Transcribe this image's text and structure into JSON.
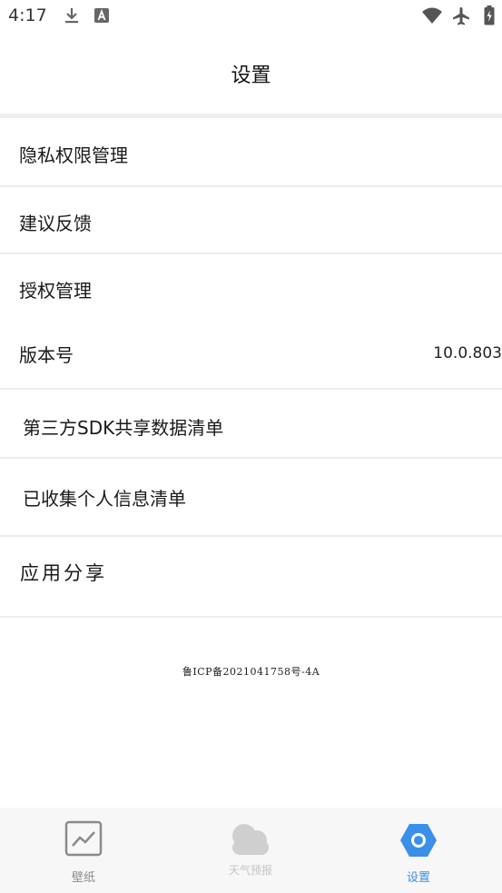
{
  "status_bar": {
    "time": "4:17",
    "left_icons": [
      "download-icon",
      "a-badge-icon"
    ],
    "right_icons": [
      "wifi-icon",
      "airplane-icon",
      "battery-charging-icon"
    ]
  },
  "header": {
    "title": "设置"
  },
  "settings": {
    "items": [
      {
        "label": "隐私权限管理"
      },
      {
        "label": "建议反馈"
      },
      {
        "label": "授权管理"
      },
      {
        "label": "版本号",
        "value": "10.0.803"
      },
      {
        "label": "第三方SDK共享数据清单"
      },
      {
        "label": "已收集个人信息清单"
      },
      {
        "label": "应用分享"
      }
    ]
  },
  "footer": {
    "icp": "鲁ICP备2021041758号-4A"
  },
  "tabs": [
    {
      "label": "壁纸",
      "icon": "image-icon",
      "active": false
    },
    {
      "label": "天气预报",
      "icon": "cloud-icon",
      "active": false
    },
    {
      "label": "设置",
      "icon": "settings-hexagon-icon",
      "active": true
    }
  ],
  "colors": {
    "accent": "#3a8fe8",
    "inactive": "#8a8a8a",
    "disabled": "#c4c4c4"
  }
}
